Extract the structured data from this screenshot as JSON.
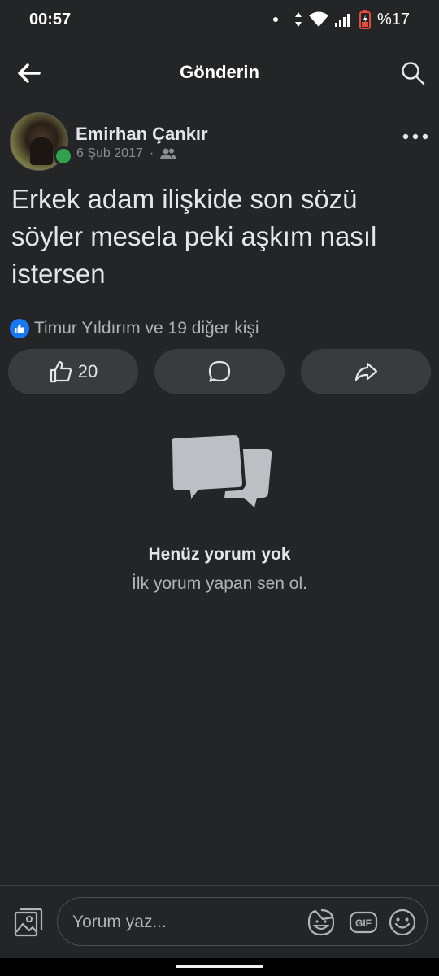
{
  "status_bar": {
    "time": "00:57",
    "battery_percent": "%17",
    "icons": [
      "notification-dot-icon",
      "data-arrows-icon",
      "wifi-icon",
      "signal-icon",
      "battery-icon"
    ]
  },
  "header": {
    "title": "Gönderin",
    "back_icon": "arrow-left-icon",
    "search_icon": "search-icon"
  },
  "post": {
    "author": "Emirhan Çankır",
    "date": "6 Şub 2017",
    "separator": "·",
    "privacy_icon": "friends-icon",
    "online": true,
    "text": "Erkek adam ilişkide son sözü söyler mesela peki aşkım nasıl istersen",
    "reactions_text": "Timur Yıldırım ve 19 diğer kişi",
    "like_count": "20"
  },
  "empty_state": {
    "title": "Henüz yorum yok",
    "subtitle": "İlk yorum yapan sen ol."
  },
  "composer": {
    "placeholder": "Yorum yaz...",
    "icons": [
      "photo-icon",
      "sticker-icon",
      "gif-icon",
      "emoji-icon"
    ]
  },
  "colors": {
    "background": "#242526",
    "button_bg": "#3a3b3c",
    "primary_text": "#e4e6eb",
    "secondary_text": "#b0b3b8",
    "like_blue": "#1877f2",
    "online_green": "#31a24c"
  }
}
